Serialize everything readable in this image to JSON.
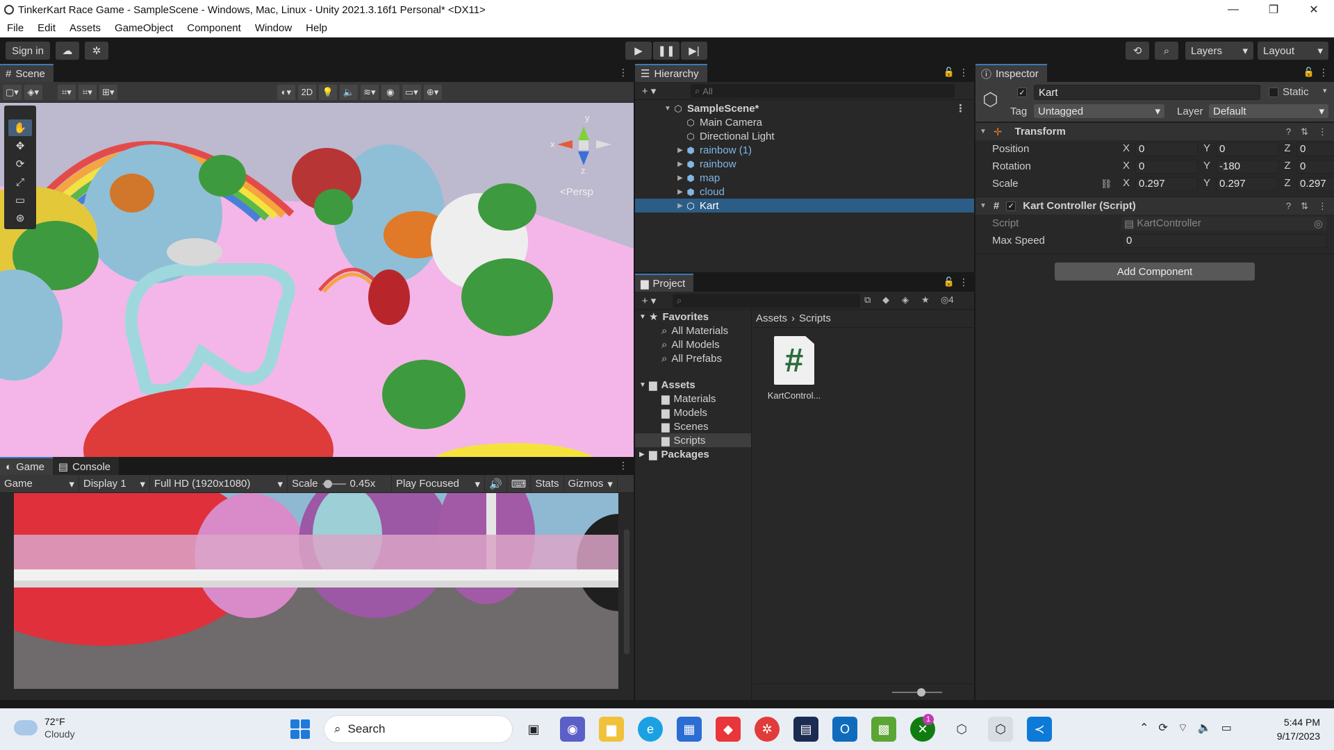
{
  "window": {
    "title": "TinkerKart Race Game - SampleScene - Windows, Mac, Linux - Unity 2021.3.16f1 Personal* <DX11>",
    "controls": [
      "—",
      "❐",
      "✕"
    ]
  },
  "menu": [
    "File",
    "Edit",
    "Assets",
    "GameObject",
    "Component",
    "Window",
    "Help"
  ],
  "toolbar": {
    "sign_in": "Sign in",
    "layers": "Layers",
    "layout": "Layout"
  },
  "scene": {
    "tab": "Scene",
    "mode_2d": "2D",
    "persp": "<Persp",
    "gizmo_axes": {
      "y": "y",
      "x": "x",
      "z": "z"
    }
  },
  "game": {
    "tab": "Game",
    "console_tab": "Console",
    "view": "Game",
    "display": "Display 1",
    "resolution": "Full HD (1920x1080)",
    "scale_label": "Scale",
    "scale_value": "0.45x",
    "play_mode": "Play Focused",
    "stats": "Stats",
    "gizmos": "Gizmos"
  },
  "hierarchy": {
    "tab": "Hierarchy",
    "search_placeholder": "All",
    "scene_name": "SampleScene*",
    "items": [
      {
        "label": "Main Camera",
        "prefab": false,
        "expandable": false
      },
      {
        "label": "Directional Light",
        "prefab": false,
        "expandable": false
      },
      {
        "label": "rainbow (1)",
        "prefab": true,
        "expandable": true
      },
      {
        "label": "rainbow",
        "prefab": true,
        "expandable": true
      },
      {
        "label": "map",
        "prefab": true,
        "expandable": true
      },
      {
        "label": "cloud",
        "prefab": true,
        "expandable": true
      },
      {
        "label": "Kart",
        "prefab": false,
        "expandable": true,
        "selected": true
      }
    ]
  },
  "project": {
    "tab": "Project",
    "hidden_count": "4",
    "favorites": {
      "label": "Favorites",
      "items": [
        "All Materials",
        "All Models",
        "All Prefabs"
      ]
    },
    "assets": {
      "label": "Assets",
      "items": [
        "Materials",
        "Models",
        "Scenes",
        "Scripts"
      ],
      "selected": "Scripts"
    },
    "packages": "Packages",
    "breadcrumb": [
      "Assets",
      "Scripts"
    ],
    "files": [
      {
        "name": "KartControl...",
        "icon": "#"
      }
    ]
  },
  "inspector": {
    "tab": "Inspector",
    "object_name": "Kart",
    "static_label": "Static",
    "tag_label": "Tag",
    "tag_value": "Untagged",
    "layer_label": "Layer",
    "layer_value": "Default",
    "transform": {
      "title": "Transform",
      "position": {
        "label": "Position",
        "x": "0",
        "y": "0",
        "z": "0"
      },
      "rotation": {
        "label": "Rotation",
        "x": "0",
        "y": "-180",
        "z": "0"
      },
      "scale": {
        "label": "Scale",
        "x": "0.297",
        "y": "0.297",
        "z": "0.297"
      }
    },
    "kart_controller": {
      "title": "Kart Controller (Script)",
      "script_label": "Script",
      "script_value": "KartController",
      "max_speed_label": "Max Speed",
      "max_speed_value": "0"
    },
    "add_component": "Add Component"
  },
  "taskbar": {
    "weather_temp": "72°F",
    "weather_desc": "Cloudy",
    "search": "Search",
    "time": "5:44 PM",
    "date": "9/17/2023",
    "xbox_badge": "1"
  }
}
